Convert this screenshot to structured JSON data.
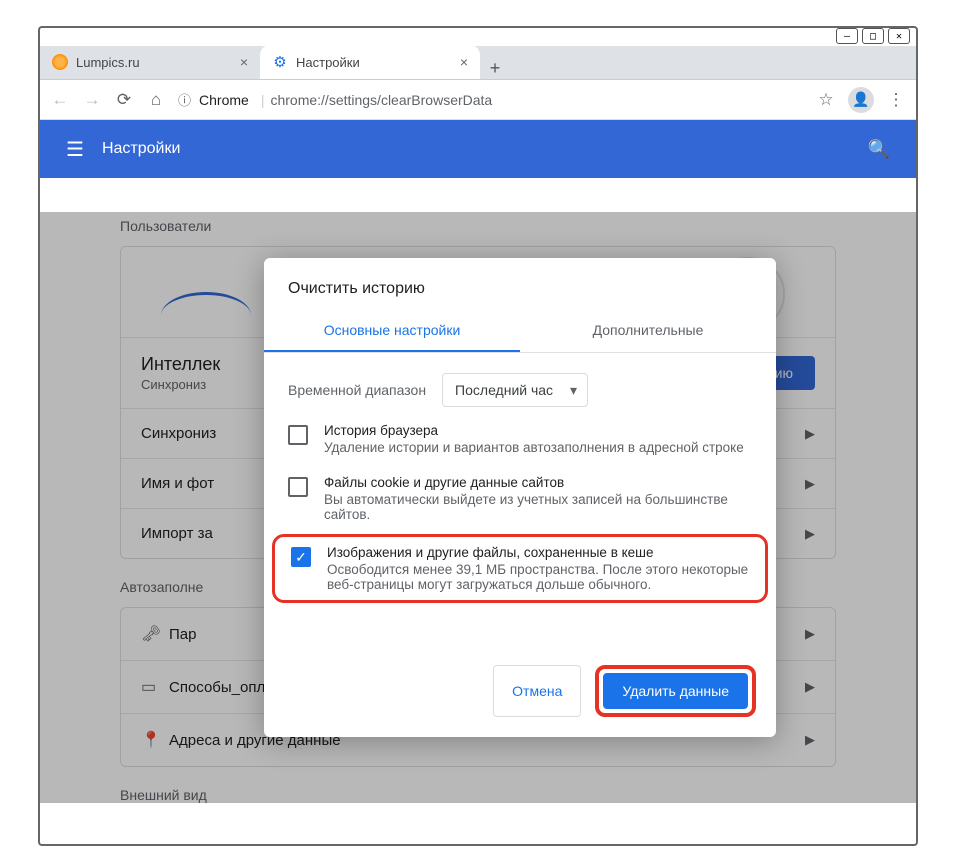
{
  "window": {
    "min": "—",
    "max": "□",
    "close": "✕"
  },
  "tabs": [
    {
      "title": "Lumpics.ru"
    },
    {
      "title": "Настройки"
    }
  ],
  "newtab": "+",
  "toolbar": {
    "secure_label": "Chrome",
    "url_prefix": "chrome://",
    "url_path": "settings/clearBrowserData"
  },
  "appbar": {
    "title": "Настройки"
  },
  "sections": {
    "users_title": "Пользователи",
    "intel_title": "Интеллек",
    "intel_sub": "Синхрониз",
    "sync_button": "зацию",
    "rows": {
      "sync": "Синхрониз",
      "name": "Имя и фот",
      "import": "Импорт за"
    },
    "autofill_title": "Автозаполне",
    "autofill_rows": {
      "passwords": "Пар",
      "payments": "Способы_оплаты",
      "addresses": "Адреса и другие данные"
    },
    "appearance_title": "Внешний вид"
  },
  "dialog": {
    "title": "Очистить историю",
    "tab_basic": "Основные настройки",
    "tab_advanced": "Дополнительные",
    "range_label": "Временной диапазон",
    "range_value": "Последний час",
    "items": [
      {
        "title": "История браузера",
        "desc": "Удаление истории и вариантов автозаполнения в адресной строке",
        "checked": false
      },
      {
        "title": "Файлы cookie и другие данные сайтов",
        "desc": "Вы автоматически выйдете из учетных записей на большинстве сайтов.",
        "checked": false
      },
      {
        "title": "Изображения и другие файлы, сохраненные в кеше",
        "desc": "Освободится менее 39,1 МБ пространства. После этого некоторые веб-страницы могут загружаться дольше обычного.",
        "checked": true
      }
    ],
    "cancel": "Отмена",
    "confirm": "Удалить данные"
  }
}
